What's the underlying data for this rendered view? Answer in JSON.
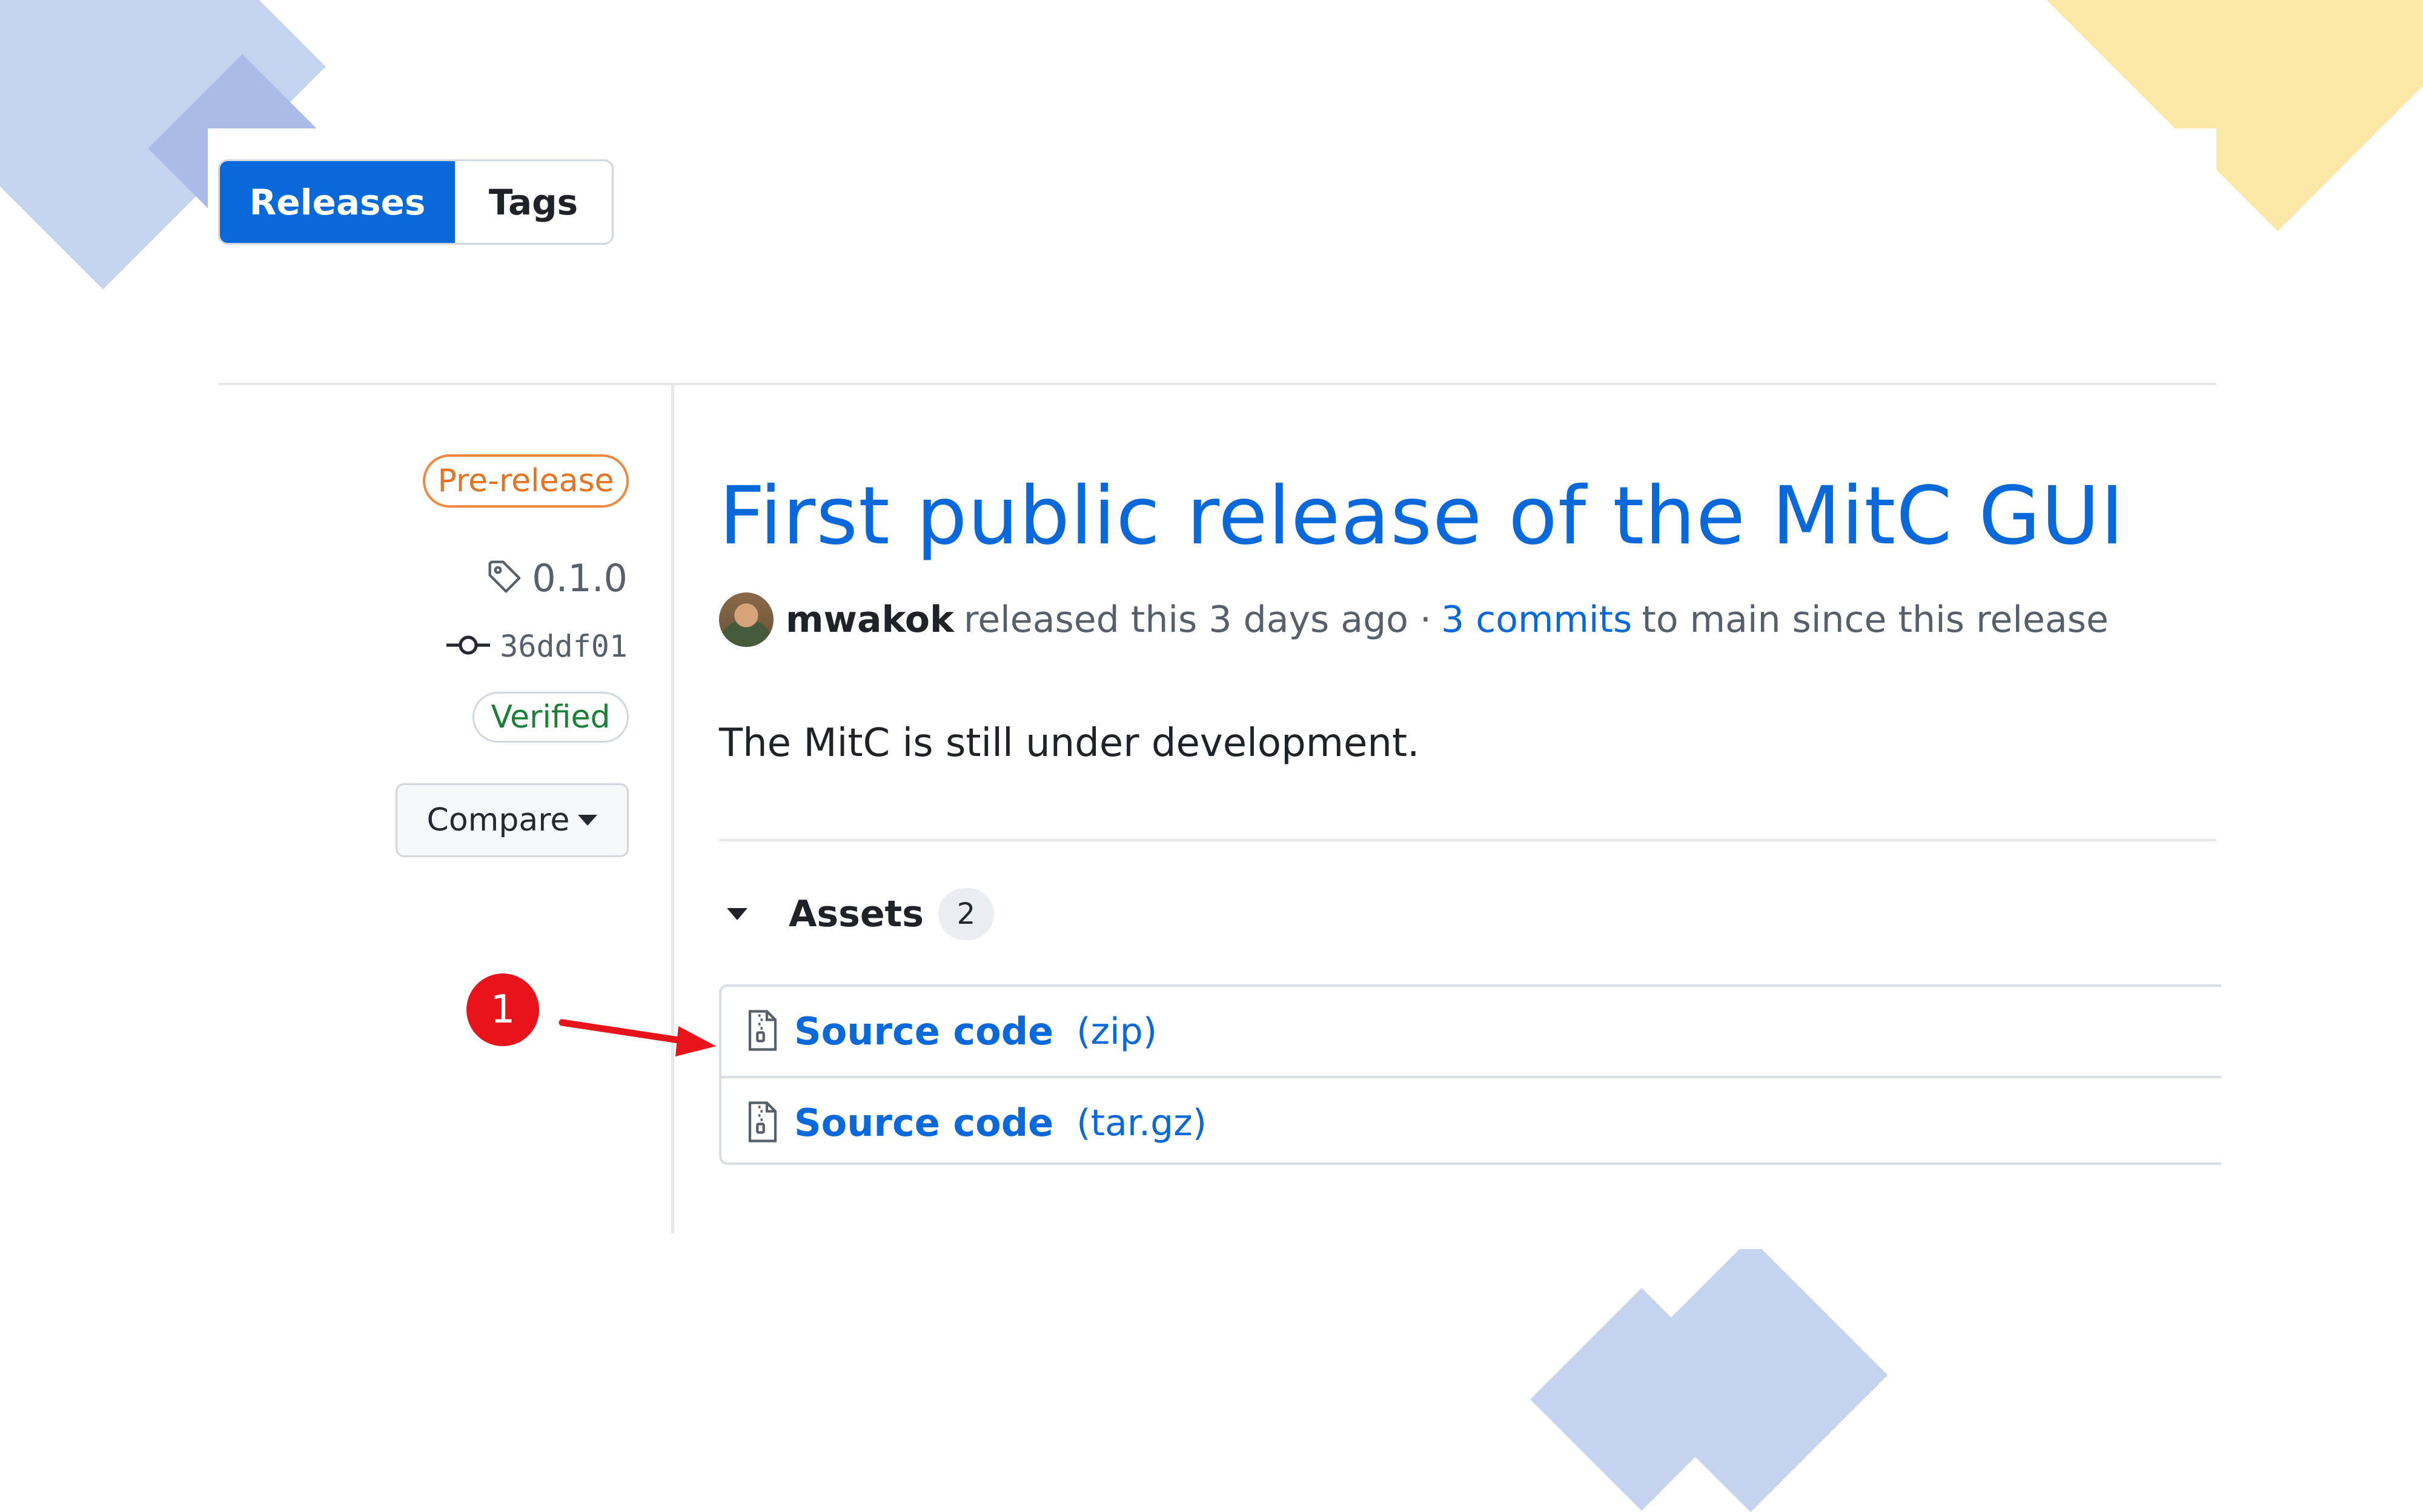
{
  "tabs": {
    "releases": "Releases",
    "tags": "Tags"
  },
  "sidebar": {
    "prerelease_badge": "Pre-release",
    "tag_version": "0.1.0",
    "commit_sha": "36ddf01",
    "verified_badge": "Verified",
    "compare_button": "Compare"
  },
  "release": {
    "title": "First public release of the MitC GUI",
    "author": "mwakok",
    "released_text": "released this 3 days ago ·",
    "commits_link": "3 commits",
    "commits_suffix": "to main since this release",
    "description": "The MitC is still under development."
  },
  "assets": {
    "label": "Assets",
    "count": "2",
    "items": [
      {
        "name": "Source code",
        "ext": "(zip)"
      },
      {
        "name": "Source code",
        "ext": "(tar.gz)"
      }
    ]
  },
  "annotation": {
    "step": "1"
  },
  "colors": {
    "accent_blue": "#0969da",
    "prerelease_orange": "#e5731f",
    "verified_green": "#1a7f37",
    "annotation_red": "#e8131b",
    "deco_blue": "#c5d3ee",
    "deco_yellow": "#fbe8a6"
  }
}
